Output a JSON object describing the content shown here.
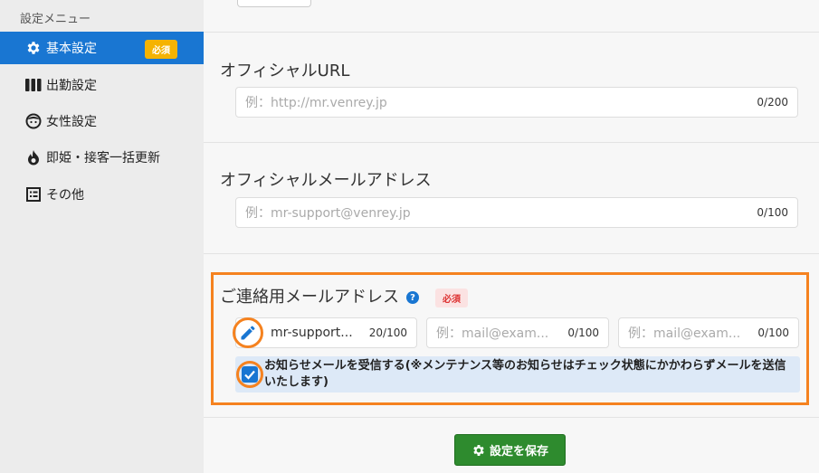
{
  "sidebar": {
    "title": "設定メニュー",
    "items": [
      {
        "label": "基本設定",
        "icon": "gear-icon",
        "active": true,
        "badge": "必須"
      },
      {
        "label": "出勤設定",
        "icon": "calendar-bars-icon",
        "active": false
      },
      {
        "label": "女性設定",
        "icon": "face-icon",
        "active": false
      },
      {
        "label": "即姫・接客一括更新",
        "icon": "flame-icon",
        "active": false
      },
      {
        "label": "その他",
        "icon": "list-icon",
        "active": false
      }
    ]
  },
  "official_url": {
    "title": "オフィシャルURL",
    "placeholder": "例：http://mr.venrey.jp",
    "counter": "0/200"
  },
  "official_mail": {
    "title": "オフィシャルメールアドレス",
    "placeholder": "例：mr-support@venrey.jp",
    "counter": "0/100"
  },
  "contact_mail": {
    "title": "ご連絡用メールアドレス",
    "help": "?",
    "badge": "必須",
    "fields": [
      {
        "value": "mr-support...",
        "placeholder": "",
        "counter": "20/100"
      },
      {
        "value": "",
        "placeholder": "例：mail@exam...",
        "counter": "0/100"
      },
      {
        "value": "",
        "placeholder": "例：mail@exam...",
        "counter": "0/100"
      }
    ],
    "notify_label": "お知らせメールを受信する(※メンテナンス等のお知らせはチェック状態にかかわらずメールを送信いたします)",
    "notify_checked": true
  },
  "save_button": {
    "label": "設定を保存",
    "icon": "gear-icon"
  },
  "colors": {
    "primary": "#1976d2",
    "highlight": "#f5821f",
    "save": "#2e8b2e",
    "badge_yellow": "#f5b301",
    "badge_red_bg": "#fbe2e2"
  }
}
